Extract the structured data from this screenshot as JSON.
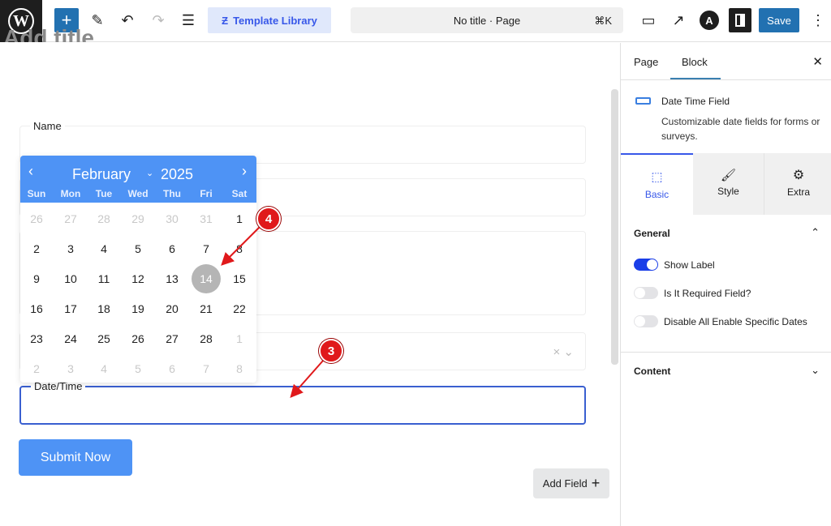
{
  "toolbar": {
    "template_library": "Template Library",
    "command": "No title · Page",
    "shortcut": "⌘K",
    "save": "Save"
  },
  "editor": {
    "title_placeholder": "Add title"
  },
  "form": {
    "fields": [
      {
        "label": "Name"
      },
      {
        "label": ""
      },
      {
        "label": ""
      },
      {
        "label": ""
      }
    ],
    "select_clear": "×",
    "datetime_label": "Date/Time",
    "submit": "Submit Now",
    "add_field": "Add Field"
  },
  "calendar": {
    "month": "February",
    "year": "2025",
    "weekdays": [
      "Sun",
      "Mon",
      "Tue",
      "Wed",
      "Thu",
      "Fri",
      "Sat"
    ],
    "weeks": [
      [
        26,
        27,
        28,
        29,
        30,
        31,
        1
      ],
      [
        2,
        3,
        4,
        5,
        6,
        7,
        8
      ],
      [
        9,
        10,
        11,
        12,
        13,
        14,
        15
      ],
      [
        16,
        17,
        18,
        19,
        20,
        21,
        22
      ],
      [
        23,
        24,
        25,
        26,
        27,
        28,
        1
      ],
      [
        2,
        3,
        4,
        5,
        6,
        7,
        8
      ]
    ],
    "selected": 14,
    "accent": "#4e93f5"
  },
  "annotations": [
    {
      "label": "4"
    },
    {
      "label": "3"
    }
  ],
  "sidebar": {
    "tabs": [
      "Page",
      "Block"
    ],
    "active_tab": "Block",
    "block_title": "Date Time Field",
    "block_desc": "Customizable date fields for forms or surveys.",
    "subtabs": [
      "Basic",
      "Style",
      "Extra"
    ],
    "general": "General",
    "toggles": [
      {
        "label": "Show Label",
        "on": true
      },
      {
        "label": "Is It Required Field?",
        "on": false
      },
      {
        "label": "Disable All Enable Specific Dates",
        "on": false
      }
    ],
    "content": "Content"
  }
}
